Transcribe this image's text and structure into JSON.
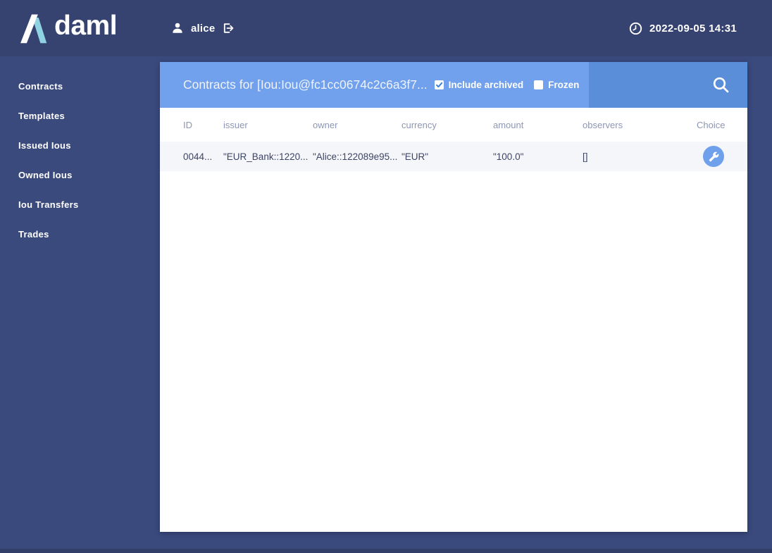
{
  "topbar": {
    "logo_text": "daml",
    "user_name": "alice",
    "timestamp": "2022-09-05 14:31"
  },
  "sidebar": {
    "items": [
      {
        "label": "Contracts"
      },
      {
        "label": "Templates"
      },
      {
        "label": "Issued Ious"
      },
      {
        "label": "Owned Ious"
      },
      {
        "label": "Iou Transfers"
      },
      {
        "label": "Trades"
      }
    ]
  },
  "main": {
    "header": {
      "title": "Contracts for [Iou:Iou@fc1cc0674c2c6a3f7...",
      "include_archived_label": "Include archived",
      "include_archived_checked": true,
      "frozen_label": "Frozen",
      "frozen_checked": false
    },
    "table": {
      "columns": [
        "ID",
        "issuer",
        "owner",
        "currency",
        "amount",
        "observers",
        "Choice"
      ],
      "rows": [
        {
          "id": "0044...",
          "issuer": "\"EUR_Bank::1220...",
          "owner": "\"Alice::122089e95...",
          "currency": "\"EUR\"",
          "amount": "\"100.0\"",
          "observers": "[]"
        }
      ]
    }
  },
  "colors": {
    "background_navy": "#3b4a7d",
    "topbar_navy": "#364370",
    "header_light_blue": "#71a0ec",
    "header_search_blue": "#5b8ed8",
    "logo_cyan": "#8fd3e3",
    "row_background": "#f5f6fa",
    "table_header_text": "#8d96b4",
    "row_text": "#3d4566",
    "checkbox_check_blue": "#3b82d8",
    "choice_button_blue": "#6fa0eb"
  }
}
